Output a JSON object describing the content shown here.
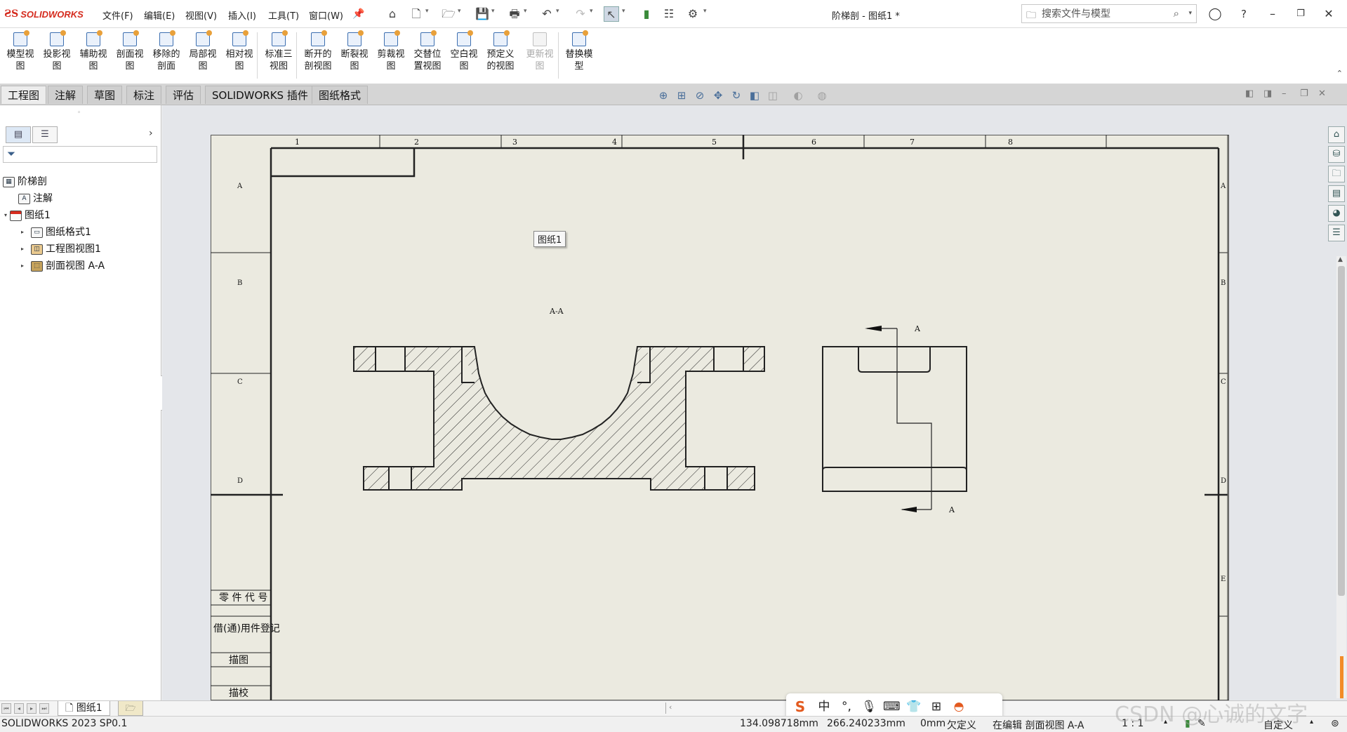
{
  "app": {
    "logo_text": "SOLIDWORKS",
    "document_title": "阶梯剖 - 图纸1 *"
  },
  "menu": [
    "文件(F)",
    "编辑(E)",
    "视图(V)",
    "插入(I)",
    "工具(T)",
    "窗口(W)"
  ],
  "search": {
    "placeholder": "搜索文件与模型"
  },
  "commands": [
    {
      "label": "模型视\n图",
      "icon": "model-view-icon",
      "enabled": true
    },
    {
      "label": "投影视\n图",
      "icon": "projected-view-icon",
      "enabled": true
    },
    {
      "label": "辅助视\n图",
      "icon": "auxiliary-view-icon",
      "enabled": true
    },
    {
      "label": "剖面视\n图",
      "icon": "section-view-icon",
      "enabled": true
    },
    {
      "label": "移除的\n剖面",
      "icon": "removed-section-icon",
      "enabled": true
    },
    {
      "label": "局部视\n图",
      "icon": "detail-view-icon",
      "enabled": true
    },
    {
      "label": "相对视\n图",
      "icon": "relative-view-icon",
      "enabled": true
    },
    {
      "label": "标准三\n视图",
      "icon": "standard-3-view-icon",
      "enabled": true
    },
    {
      "label": "断开的\n剖视图",
      "icon": "broken-out-section-icon",
      "enabled": true
    },
    {
      "label": "断裂视\n图",
      "icon": "break-view-icon",
      "enabled": true
    },
    {
      "label": "剪裁视\n图",
      "icon": "crop-view-icon",
      "enabled": true
    },
    {
      "label": "交替位\n置视图",
      "icon": "alternate-position-icon",
      "enabled": true
    },
    {
      "label": "空白视\n图",
      "icon": "empty-view-icon",
      "enabled": true
    },
    {
      "label": "预定义\n的视图",
      "icon": "predefined-view-icon",
      "enabled": true
    },
    {
      "label": "更新视\n图",
      "icon": "update-view-icon",
      "enabled": false
    },
    {
      "label": "替换模\n型",
      "icon": "replace-model-icon",
      "enabled": true
    }
  ],
  "tabs": [
    "工程图",
    "注解",
    "草图",
    "标注",
    "评估",
    "SOLIDWORKS 插件",
    "图纸格式"
  ],
  "active_tab": "工程图",
  "tree": {
    "root": "阶梯剖",
    "annotations": "注解",
    "sheet": "图纸1",
    "children": [
      "图纸格式1",
      "工程图视图1",
      "剖面视图 A-A"
    ]
  },
  "drawing": {
    "tooltip": "图纸1",
    "section_title": "A-A",
    "cut_label_top": "A",
    "cut_label_bottom": "A",
    "column_labels": [
      "1",
      "2",
      "3",
      "4",
      "5",
      "6",
      "7",
      "8"
    ],
    "row_labels": [
      "A",
      "B",
      "C",
      "D",
      "E"
    ],
    "title_block": [
      "零 件 代 号",
      "借(通)用件登记",
      "描图",
      "描校"
    ]
  },
  "sheet_tab": "图纸1",
  "status": {
    "version": "SOLIDWORKS 2023 SP0.1",
    "x": "134.098718mm",
    "y": "266.240233mm",
    "z": "0mm",
    "state": "欠定义",
    "editing": "在编辑 剖面视图 A-A",
    "scale": "1 : 1",
    "units": "自定义"
  },
  "ime": {
    "lang": "中"
  },
  "watermark": "CSDN @心诚的文字",
  "colors": {
    "brand": "#d52b1e",
    "sheet": "#ebeae0",
    "graphics_bg": "#e4e6ea"
  }
}
